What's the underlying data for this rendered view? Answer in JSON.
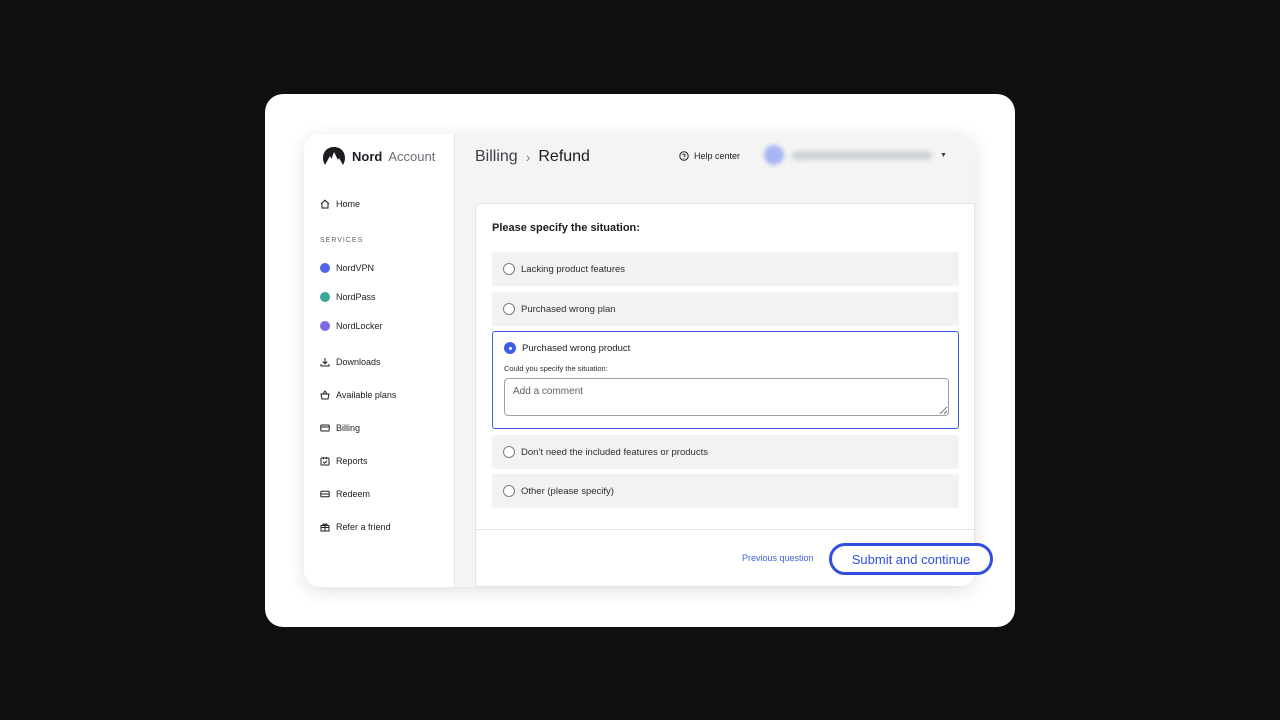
{
  "brand": {
    "name": "Nord",
    "product": "Account"
  },
  "sidebar": {
    "home": "Home",
    "services_label": "SERVICES",
    "services": [
      {
        "label": "NordVPN",
        "color": "#4f63e8"
      },
      {
        "label": "NordPass",
        "color": "#3fa39a"
      },
      {
        "label": "NordLocker",
        "color": "#7b6be6"
      }
    ],
    "items": [
      {
        "label": "Downloads",
        "icon": "download-icon"
      },
      {
        "label": "Available plans",
        "icon": "basket-icon"
      },
      {
        "label": "Billing",
        "icon": "credit-card-icon"
      },
      {
        "label": "Reports",
        "icon": "report-icon"
      },
      {
        "label": "Redeem",
        "icon": "ticket-icon"
      },
      {
        "label": "Refer a friend",
        "icon": "gift-icon"
      }
    ]
  },
  "header": {
    "breadcrumb": [
      "Billing",
      "Refund"
    ],
    "separator": "›",
    "help": "Help center",
    "account_caret": "▼"
  },
  "form": {
    "question": "Please specify the situation:",
    "options": [
      "Lacking product features",
      "Purchased wrong plan",
      "Purchased wrong product",
      "Don’t need the included features or products",
      "Other (please specify)"
    ],
    "selected_index": 2,
    "followup_label": "Could you specify the situation:",
    "comment_placeholder": "Add a comment",
    "previous": "Previous question",
    "submit": "Submit and continue"
  },
  "colors": {
    "accent": "#3e5fe3",
    "background": "#0f0f0f"
  }
}
